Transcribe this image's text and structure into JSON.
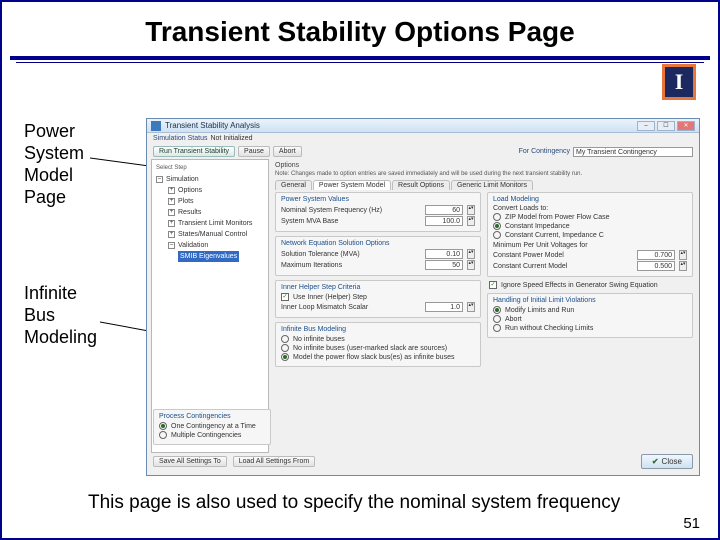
{
  "slide": {
    "title": "Transient Stability Options Page",
    "caption1_l1": "Power",
    "caption1_l2": "System",
    "caption1_l3": "Model",
    "caption1_l4": "Page",
    "caption2_l1": "Infinite",
    "caption2_l2": "Bus",
    "caption2_l3": "Modeling",
    "bottom_text": "This page is also used to specify the nominal system frequency",
    "page_no": "51",
    "logo_letter": "I"
  },
  "dialog": {
    "title": "Transient Stability Analysis",
    "min": "–",
    "max": "☐",
    "close": "✕",
    "status_label": "Simulation Status",
    "status_value": "Not Initialized",
    "run_btn": "Run Transient Stability",
    "pause_btn": "Pause",
    "abort_btn": "Abort",
    "contingency_label": "For Contingency",
    "contingency_value": "My Transient Contingency",
    "tree": {
      "root": "Select Step",
      "simulation": "Simulation",
      "options": "Options",
      "plots": "Plots",
      "results": "Results",
      "transient_models": "Transient Limit Monitors",
      "states_control": "States/Manual Control",
      "validation": "Validation",
      "sub_validation": "SMIB Eigenvalues"
    },
    "options_head": "Options",
    "note": "Note: Changes made to option entries are saved immediately and will be used during the next transient stability run.",
    "tabs": {
      "general": "General",
      "power_system_model": "Power System Model",
      "result_options": "Result Options",
      "generic_limit": "Generic Limit Monitors"
    },
    "psv": {
      "group": "Power System Values",
      "freq_label": "Nominal System Frequency (Hz)",
      "freq_val": "60",
      "mva_label": "System MVA Base",
      "mva_val": "100.0"
    },
    "net": {
      "group": "Network Equation Solution Options",
      "tol_label": "Solution Tolerance (MVA)",
      "tol_val": "0.10",
      "max_label": "Maximum Iterations",
      "max_val": "50"
    },
    "hstep": {
      "group": "Inner Helper Step Criteria",
      "chk1": "Use Inner (Helper) Step",
      "scalar": "Inner Loop Mismatch Scalar",
      "scalar_val": "1.0"
    },
    "infbus": {
      "group": "Infinite Bus Modeling",
      "opt1": "No infinite buses",
      "opt2": "No infinite buses (user-marked slack are sources)",
      "opt3": "Model the power flow slack bus(es) as infinite buses"
    },
    "load": {
      "group": "Load Modeling",
      "opt1": "Convert Loads to:",
      "opt2": "ZIP Model from Power Flow Case",
      "opt3": "Constant Impedance",
      "opt4": "Constant Current, Impedance C",
      "minvolt": "Minimum Per Unit Voltages for",
      "cp": "Constant Power Model",
      "cp_val": "0.700",
      "cc": "Constant Current Model",
      "cc_val": "0.500"
    },
    "speed": {
      "chk": "Ignore Speed Effects in Generator Swing Equation"
    },
    "limits": {
      "group": "Handling of Initial Limit Violations",
      "opt1": "Modify Limits and Run",
      "opt2": "Abort",
      "opt3": "Run without Checking Limits"
    },
    "procgroup": {
      "title": "Process Contingencies",
      "opt1": "One Contingency at a Time",
      "opt2": "Multiple Contingencies"
    },
    "save_btn": "Save All Settings To",
    "load_btn": "Load All Settings From",
    "close_btn": "Close"
  }
}
